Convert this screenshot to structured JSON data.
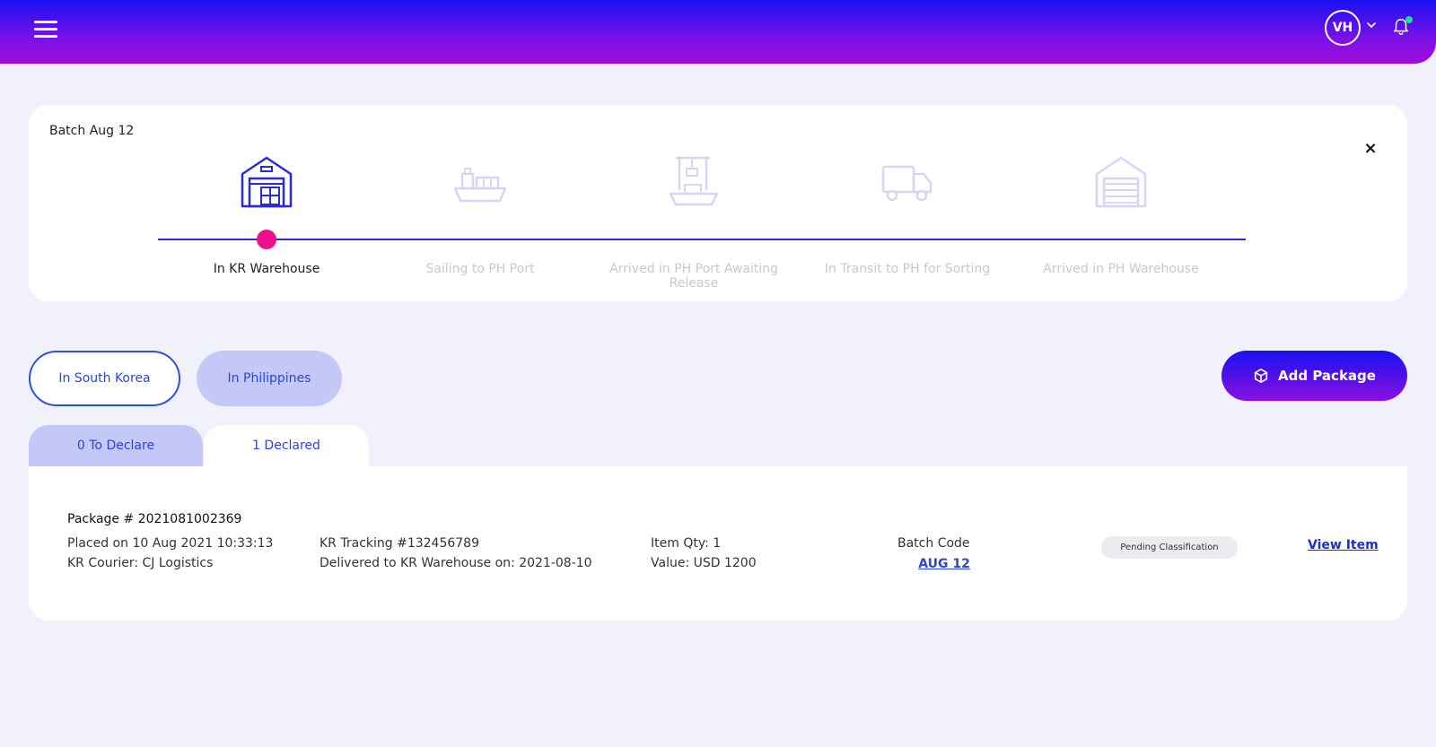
{
  "header": {
    "menu_icon": "hamburger-icon",
    "avatar_initials": "VH",
    "notification_icon": "bell-icon",
    "accent_color": "#19e0a8"
  },
  "batch": {
    "title": "Batch Aug 12",
    "close_label": "×",
    "steps": [
      {
        "label": "In KR Warehouse",
        "icon": "warehouse-icon",
        "active": true
      },
      {
        "label": "Sailing to PH Port",
        "icon": "ship-icon",
        "active": false
      },
      {
        "label": "Arrived in PH Port Awaiting Release",
        "icon": "port-crane-icon",
        "active": false
      },
      {
        "label": "In Transit to PH for Sorting",
        "icon": "truck-icon",
        "active": false
      },
      {
        "label": "Arrived in PH Warehouse",
        "icon": "warehouse-icon",
        "active": false
      }
    ],
    "progress_color": "#ec0e8c"
  },
  "location": {
    "korea_label": "In South Korea",
    "ph_label": "In Philippines"
  },
  "add_package_label": "Add Package",
  "tabs": {
    "to_declare": "0 To Declare",
    "declared": "1 Declared"
  },
  "package": {
    "title": "Package # 2021081002369",
    "placed_on": "Placed on 10 Aug 2021 10:33:13",
    "courier": "KR Courier: CJ Logistics",
    "tracking": "KR Tracking #132456789",
    "delivered": "Delivered to KR Warehouse on: 2021-08-10",
    "item_qty": "Item Qty: 1",
    "value": "Value: USD 1200",
    "batch_code_label": "Batch Code",
    "batch_code": "AUG 12",
    "status": "Pending Classification",
    "view_label": "View Item"
  }
}
